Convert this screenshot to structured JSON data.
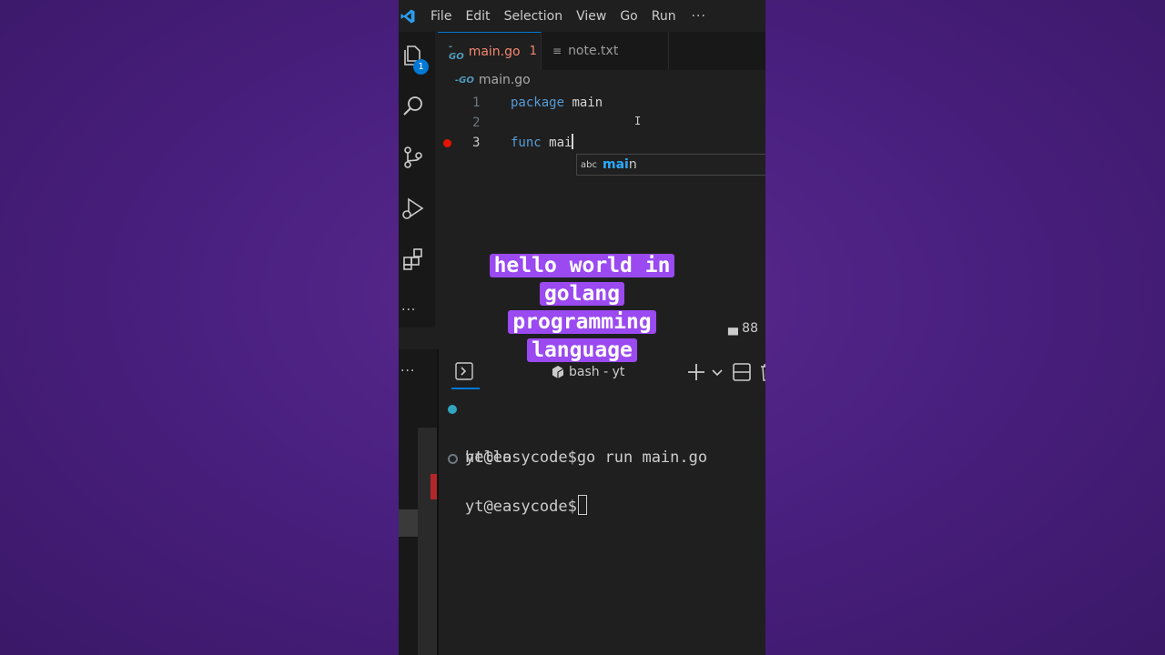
{
  "menu": {
    "items": [
      "File",
      "Edit",
      "Selection",
      "View",
      "Go",
      "Run"
    ],
    "more": "···"
  },
  "activity_bar": {
    "explorer_badge": "1",
    "more": "···"
  },
  "tabs": [
    {
      "icon": "-GO",
      "label": "main.go",
      "problems": "1",
      "modified": true
    },
    {
      "icon": "≡",
      "label": "note.txt"
    }
  ],
  "breadcrumb": {
    "icon": "-GO",
    "label": "main.go"
  },
  "code": {
    "lines": [
      {
        "number": "1",
        "keyword": "package",
        "rest": " main"
      },
      {
        "number": "2",
        "keyword": "",
        "rest": ""
      },
      {
        "number": "3",
        "keyword": "func",
        "rest": " mai"
      }
    ],
    "text_cursor": "I"
  },
  "suggestion": {
    "kind": "abc",
    "match": "mai",
    "rest": "n"
  },
  "panel_partial": "▄ 88",
  "terminal": {
    "more": "···",
    "shell_label": "bash - yt",
    "lines": [
      {
        "text": "yt@easycode$go run main.go"
      },
      {
        "text": "hello"
      },
      {
        "text": "yt@easycode$"
      }
    ]
  },
  "caption": {
    "lines": [
      "hello world in",
      "golang",
      "programming",
      "language"
    ]
  },
  "colors": {
    "background": "#4a2080",
    "caption_bg": "#9a4af0",
    "accent": "#0078d4",
    "breakpoint": "#e51400",
    "error_tab": "#f48771"
  }
}
